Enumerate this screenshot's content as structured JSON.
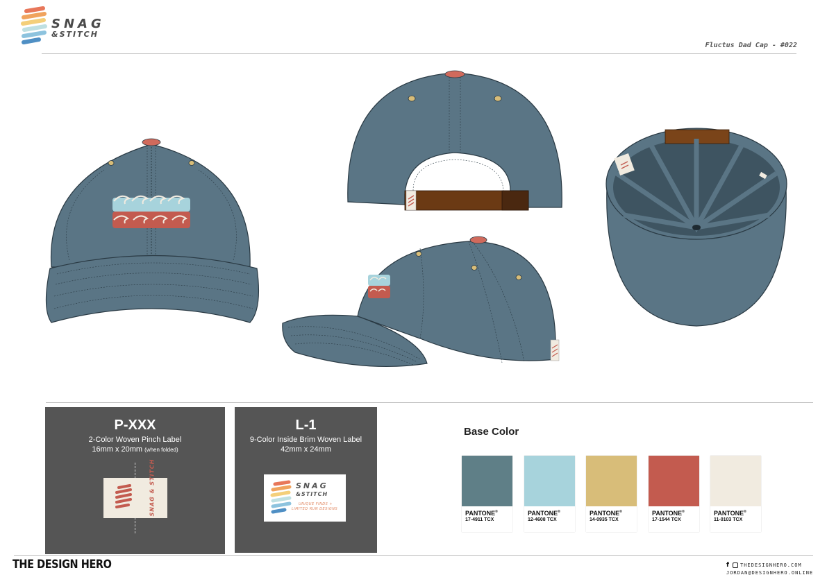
{
  "header": {
    "brand_name": "SNAG",
    "brand_sub": "&STITCH",
    "doc_title": "Fluctus Dad Cap - #022"
  },
  "labels": [
    {
      "code": "P-XXX",
      "description": "2-Color Woven Pinch Label",
      "size": "16mm x 20mm",
      "size_note": "(when folded)",
      "label_text": "SNAG & STITCH"
    },
    {
      "code": "L-1",
      "description": "9-Color Inside Brim Woven Label",
      "size": "42mm x 24mm",
      "size_note": "",
      "label_brand": "SNAG",
      "label_sub": "&STITCH",
      "label_tagline_1": "UNIQUE FINDS +",
      "label_tagline_2": "LIMITED RUN DESIGNS"
    }
  ],
  "base_color": {
    "title": "Base Color",
    "swatches": [
      {
        "brand": "PANTONE",
        "code": "17-4911 TCX",
        "hex": "#5f7f87"
      },
      {
        "brand": "PANTONE",
        "code": "12-4608 TCX",
        "hex": "#a7d3dc"
      },
      {
        "brand": "PANTONE",
        "code": "14-0935 TCX",
        "hex": "#d8bd79"
      },
      {
        "brand": "PANTONE",
        "code": "17-1544 TCX",
        "hex": "#c35b4f"
      },
      {
        "brand": "PANTONE",
        "code": "11-0103 TCX",
        "hex": "#f1ebe0"
      }
    ]
  },
  "colors": {
    "cap": "#5a7585",
    "cap_dark": "#3e5461",
    "button": "#d06a5c",
    "strap": "#6b3a14",
    "panel": "#555555"
  },
  "footer": {
    "brand": "THE DESIGN HERO",
    "website": "THEDESIGNHERO.COM",
    "email": "JORDAN@DESIGNHERO.ONLINE"
  }
}
